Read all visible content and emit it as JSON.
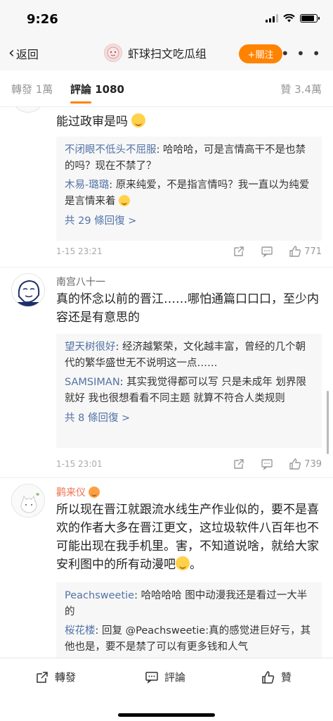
{
  "status": {
    "time": "9:26"
  },
  "nav": {
    "back_label": "返回",
    "title": "虾球扫文吃瓜组",
    "follow_label": "+關注",
    "more_label": "• • •"
  },
  "tabs": {
    "repost": "轉發 1萬",
    "comments": "評論 1080",
    "likes": "贊 3.4萬"
  },
  "comments": [
    {
      "text": "能过政审是吗",
      "replies": [
        {
          "name": "不闭眼不低头不屈服",
          "text": ": 哈哈哈，可是言情高干不是也禁的吗？现在不禁了？"
        },
        {
          "name": "木易-璐璐",
          "text": ": 原来纯爱，不是指言情吗？我一直以为纯爱是言情来着"
        }
      ],
      "more_replies": "共 29 條回復 >",
      "date": "1-15 23:21",
      "likes": "771"
    },
    {
      "name": "南宫八十一",
      "text": "真的怀念以前的晋江……哪怕通篇口口口，至少内容还是有意思的",
      "replies": [
        {
          "name": "望天树很好",
          "text": ": 经济越繁荣，文化越丰富，曾经的几个朝代的繁华盛世无不说明这一点……"
        },
        {
          "name": "SAMSIMAN",
          "text": ": 其实我觉得都可以写 只是未成年 划界限就好 我也很想看看不同主题 就算不符合人类规则"
        }
      ],
      "more_replies": "共 8 條回復 >",
      "date": "1-15 23:01",
      "likes": "739"
    },
    {
      "name": "鹳来仪",
      "text": "所以现在晋江就跟流水线生产作业似的，要不是喜欢的作者大多在晋江更文，这垃圾软件八百年也不可能出现在我手机里。害，不知道说啥，就给大家安利图中的所有动漫吧",
      "text_end": "。",
      "replies": [
        {
          "name": "Peachsweetie",
          "text": ": 哈哈哈哈 图中动漫我还是看过一大半的"
        },
        {
          "name": "桜花楼",
          "text": ": 回复 @Peachsweetie:真的感觉进巨好亏，其他也是，要不是禁了可以有更多钱和人气"
        }
      ]
    }
  ],
  "bottom": {
    "repost_label": "轉發",
    "comment_label": "評論",
    "like_label": "贊"
  }
}
